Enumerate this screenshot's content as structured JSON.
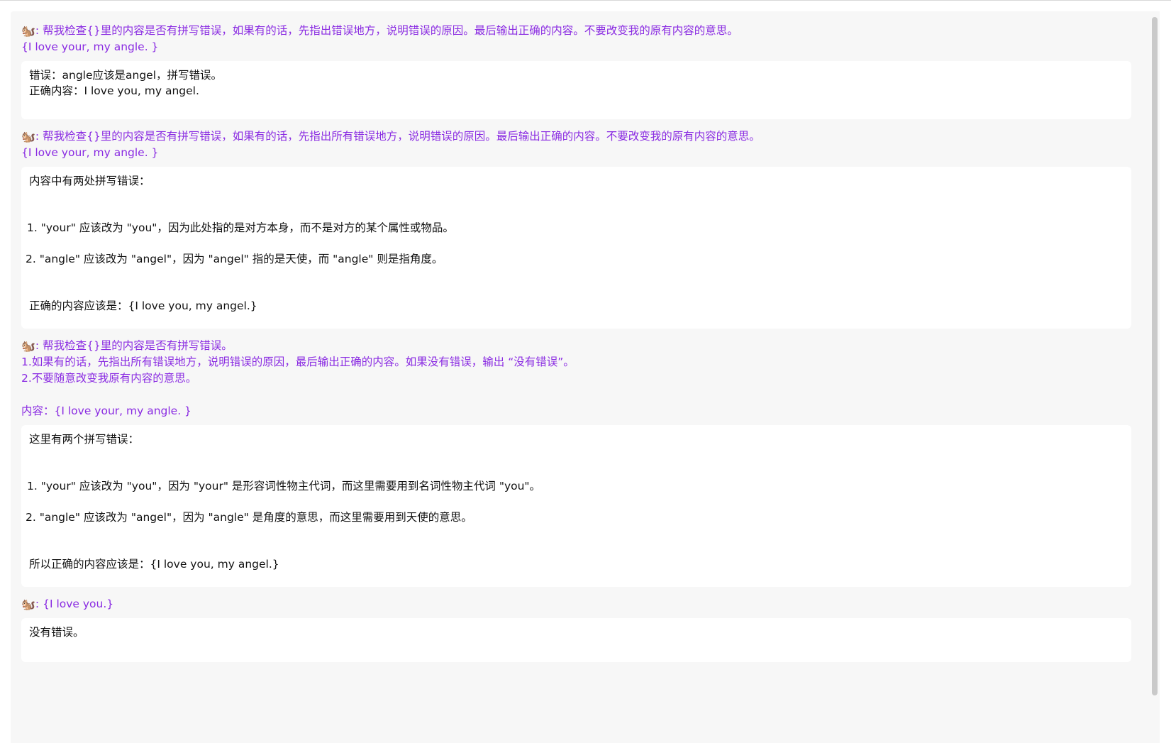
{
  "conversation": [
    {
      "prompt_lines": [
        "帮我检查{}里的内容是否有拼写错误，如果有的话，先指出错误地方，说明错误的原因。最后输出正确的内容。不要改变我的原有内容的意思。",
        "{I love your, my angle. }"
      ],
      "reply_lines": [
        "错误：angle应该是angel，拼写错误。",
        "正确内容：I love you, my angel."
      ]
    },
    {
      "prompt_lines": [
        "帮我检查{}里的内容是否有拼写错误，如果有的话，先指出所有错误地方，说明错误的原因。最后输出正确的内容。不要改变我的原有内容的意思。",
        "{I love your, my angle. }"
      ],
      "reply_lines": [
        "内容中有两处拼写错误：",
        "1. \"your\" 应该改为 \"you\"，因为此处指的是对方本身，而不是对方的某个属性或物品。",
        "2. \"angle\" 应该改为 \"angel\"，因为 \"angel\" 指的是天使，而 \"angle\" 则是指角度。",
        "正确的内容应该是：{I love you, my angel.}"
      ]
    },
    {
      "prompt_lines": [
        "帮我检查{}里的内容是否有拼写错误。",
        "1.如果有的话，先指出所有错误地方，说明错误的原因，最后输出正确的内容。如果没有错误，输出 “没有错误”。",
        "2.不要随意改变我原有内容的意思。",
        "内容：{I love your, my angle. }"
      ],
      "reply_lines": [
        "这里有两个拼写错误：",
        "1. \"your\" 应该改为 \"you\"，因为 \"your\" 是形容词性物主代词，而这里需要用到名词性物主代词 \"you\"。",
        "2. \"angle\" 应该改为 \"angel\"，因为 \"angle\" 是角度的意思，而这里需要用到天使的意思。",
        "所以正确的内容应该是：{I love you, my angel.}"
      ]
    },
    {
      "prompt_lines": [
        "{I love you.}"
      ],
      "reply_lines": [
        "没有错误。"
      ]
    }
  ],
  "avatar_icon": "squirrel-avatar-icon",
  "colors": {
    "prompt_text": "#8a2be2",
    "reply_text": "#111111",
    "panel_bg": "#f7f7f7",
    "reply_bg": "#ffffff"
  }
}
